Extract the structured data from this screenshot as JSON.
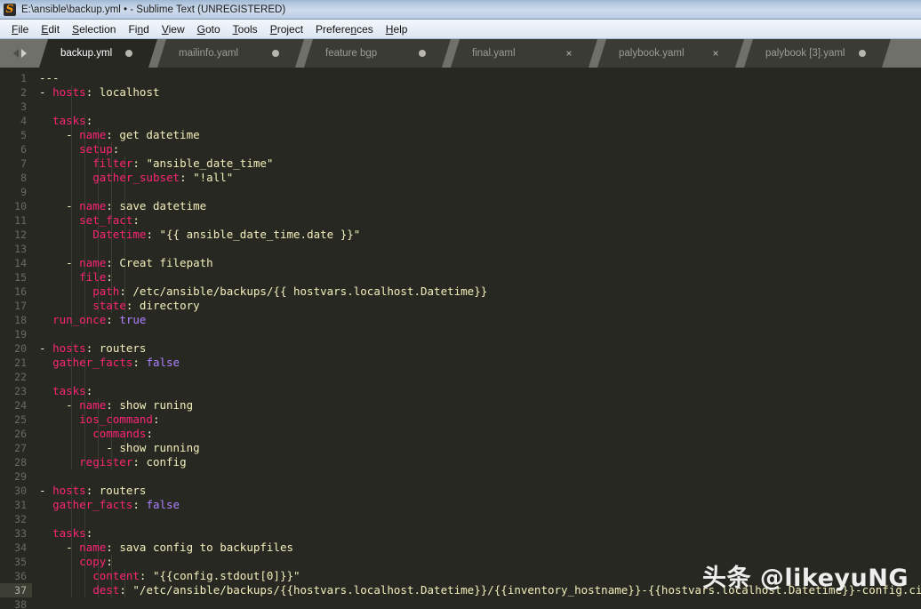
{
  "window": {
    "title": "E:\\ansible\\backup.yml • - Sublime Text (UNREGISTERED)",
    "logo_icon": "sublime-text-logo-icon"
  },
  "menu": {
    "items": [
      {
        "label": "File",
        "mnemonic": "F"
      },
      {
        "label": "Edit",
        "mnemonic": "E"
      },
      {
        "label": "Selection",
        "mnemonic": "S"
      },
      {
        "label": "Find",
        "mnemonic": "n"
      },
      {
        "label": "View",
        "mnemonic": "V"
      },
      {
        "label": "Goto",
        "mnemonic": "G"
      },
      {
        "label": "Tools",
        "mnemonic": "T"
      },
      {
        "label": "Project",
        "mnemonic": "P"
      },
      {
        "label": "Preferences",
        "mnemonic": "n"
      },
      {
        "label": "Help",
        "mnemonic": "H"
      }
    ]
  },
  "tabbar": {
    "prev_icon": "chevron-left-icon",
    "next_icon": "chevron-right-icon",
    "tabs": [
      {
        "label": "backup.yml",
        "active": true,
        "icon": "modified-dot-icon",
        "width": 133
      },
      {
        "label": "mailinfo.yaml",
        "active": false,
        "icon": "modified-dot-icon",
        "width": 165
      },
      {
        "label": "feature bgp",
        "active": false,
        "icon": "modified-dot-icon",
        "width": 165
      },
      {
        "label": "final.yaml",
        "active": false,
        "icon": "close-x-icon",
        "width": 165
      },
      {
        "label": "palybook.yaml",
        "active": false,
        "icon": "close-x-icon",
        "width": 165
      },
      {
        "label": "palybook [3].yaml",
        "active": false,
        "icon": "modified-dot-icon",
        "width": 165
      }
    ]
  },
  "editor": {
    "active_line": 37,
    "first_line": 1,
    "total_lines_shown": 38,
    "language": "YAML",
    "lines": [
      {
        "n": 1,
        "tokens": [
          {
            "t": "---",
            "c": "p"
          }
        ]
      },
      {
        "n": 2,
        "tokens": [
          {
            "t": "- ",
            "c": "d"
          },
          {
            "t": "hosts",
            "c": "k"
          },
          {
            "t": ": ",
            "c": "p"
          },
          {
            "t": "localhost",
            "c": "v"
          }
        ]
      },
      {
        "n": 3,
        "tokens": []
      },
      {
        "n": 4,
        "tokens": [
          {
            "t": "  ",
            "c": "p"
          },
          {
            "t": "tasks",
            "c": "k"
          },
          {
            "t": ":",
            "c": "p"
          }
        ]
      },
      {
        "n": 5,
        "tokens": [
          {
            "t": "    - ",
            "c": "d"
          },
          {
            "t": "name",
            "c": "k"
          },
          {
            "t": ": ",
            "c": "p"
          },
          {
            "t": "get datetime",
            "c": "v"
          }
        ]
      },
      {
        "n": 6,
        "tokens": [
          {
            "t": "      ",
            "c": "p"
          },
          {
            "t": "setup",
            "c": "k"
          },
          {
            "t": ":",
            "c": "p"
          }
        ]
      },
      {
        "n": 7,
        "tokens": [
          {
            "t": "        ",
            "c": "p"
          },
          {
            "t": "filter",
            "c": "k"
          },
          {
            "t": ": ",
            "c": "p"
          },
          {
            "t": "\"ansible_date_time\"",
            "c": "v"
          }
        ]
      },
      {
        "n": 8,
        "tokens": [
          {
            "t": "        ",
            "c": "p"
          },
          {
            "t": "gather_subset",
            "c": "k"
          },
          {
            "t": ": ",
            "c": "p"
          },
          {
            "t": "\"!all\"",
            "c": "v"
          }
        ]
      },
      {
        "n": 9,
        "tokens": []
      },
      {
        "n": 10,
        "tokens": [
          {
            "t": "    - ",
            "c": "d"
          },
          {
            "t": "name",
            "c": "k"
          },
          {
            "t": ": ",
            "c": "p"
          },
          {
            "t": "save datetime",
            "c": "v"
          }
        ]
      },
      {
        "n": 11,
        "tokens": [
          {
            "t": "      ",
            "c": "p"
          },
          {
            "t": "set_fact",
            "c": "k"
          },
          {
            "t": ":",
            "c": "p"
          }
        ]
      },
      {
        "n": 12,
        "tokens": [
          {
            "t": "        ",
            "c": "p"
          },
          {
            "t": "Datetime",
            "c": "k"
          },
          {
            "t": ": ",
            "c": "p"
          },
          {
            "t": "\"{{ ansible_date_time.date }}\"",
            "c": "v"
          }
        ]
      },
      {
        "n": 13,
        "tokens": []
      },
      {
        "n": 14,
        "tokens": [
          {
            "t": "    - ",
            "c": "d"
          },
          {
            "t": "name",
            "c": "k"
          },
          {
            "t": ": ",
            "c": "p"
          },
          {
            "t": "Creat filepath",
            "c": "v"
          }
        ]
      },
      {
        "n": 15,
        "tokens": [
          {
            "t": "      ",
            "c": "p"
          },
          {
            "t": "file",
            "c": "k"
          },
          {
            "t": ":",
            "c": "p"
          }
        ]
      },
      {
        "n": 16,
        "tokens": [
          {
            "t": "        ",
            "c": "p"
          },
          {
            "t": "path",
            "c": "k"
          },
          {
            "t": ": ",
            "c": "p"
          },
          {
            "t": "/etc/ansible/backups/{{ hostvars.localhost.Datetime}}",
            "c": "v"
          }
        ]
      },
      {
        "n": 17,
        "tokens": [
          {
            "t": "        ",
            "c": "p"
          },
          {
            "t": "state",
            "c": "k"
          },
          {
            "t": ": ",
            "c": "p"
          },
          {
            "t": "directory",
            "c": "v"
          }
        ]
      },
      {
        "n": 18,
        "tokens": [
          {
            "t": "  ",
            "c": "p"
          },
          {
            "t": "run_once",
            "c": "k"
          },
          {
            "t": ": ",
            "c": "p"
          },
          {
            "t": "true",
            "c": "b"
          }
        ]
      },
      {
        "n": 19,
        "tokens": []
      },
      {
        "n": 20,
        "tokens": [
          {
            "t": "- ",
            "c": "d"
          },
          {
            "t": "hosts",
            "c": "k"
          },
          {
            "t": ": ",
            "c": "p"
          },
          {
            "t": "routers",
            "c": "v"
          }
        ]
      },
      {
        "n": 21,
        "tokens": [
          {
            "t": "  ",
            "c": "p"
          },
          {
            "t": "gather_facts",
            "c": "k"
          },
          {
            "t": ": ",
            "c": "p"
          },
          {
            "t": "false",
            "c": "b"
          }
        ]
      },
      {
        "n": 22,
        "tokens": []
      },
      {
        "n": 23,
        "tokens": [
          {
            "t": "  ",
            "c": "p"
          },
          {
            "t": "tasks",
            "c": "k"
          },
          {
            "t": ":",
            "c": "p"
          }
        ]
      },
      {
        "n": 24,
        "tokens": [
          {
            "t": "    - ",
            "c": "d"
          },
          {
            "t": "name",
            "c": "k"
          },
          {
            "t": ": ",
            "c": "p"
          },
          {
            "t": "show runing",
            "c": "v"
          }
        ]
      },
      {
        "n": 25,
        "tokens": [
          {
            "t": "      ",
            "c": "p"
          },
          {
            "t": "ios_command",
            "c": "k"
          },
          {
            "t": ":",
            "c": "p"
          }
        ]
      },
      {
        "n": 26,
        "tokens": [
          {
            "t": "        ",
            "c": "p"
          },
          {
            "t": "commands",
            "c": "k"
          },
          {
            "t": ":",
            "c": "p"
          }
        ]
      },
      {
        "n": 27,
        "tokens": [
          {
            "t": "          - ",
            "c": "d"
          },
          {
            "t": "show running",
            "c": "v"
          }
        ]
      },
      {
        "n": 28,
        "tokens": [
          {
            "t": "      ",
            "c": "p"
          },
          {
            "t": "register",
            "c": "k"
          },
          {
            "t": ": ",
            "c": "p"
          },
          {
            "t": "config",
            "c": "v"
          }
        ]
      },
      {
        "n": 29,
        "tokens": []
      },
      {
        "n": 30,
        "tokens": [
          {
            "t": "- ",
            "c": "d"
          },
          {
            "t": "hosts",
            "c": "k"
          },
          {
            "t": ": ",
            "c": "p"
          },
          {
            "t": "routers",
            "c": "v"
          }
        ]
      },
      {
        "n": 31,
        "tokens": [
          {
            "t": "  ",
            "c": "p"
          },
          {
            "t": "gather_facts",
            "c": "k"
          },
          {
            "t": ": ",
            "c": "p"
          },
          {
            "t": "false",
            "c": "b"
          }
        ]
      },
      {
        "n": 32,
        "tokens": []
      },
      {
        "n": 33,
        "tokens": [
          {
            "t": "  ",
            "c": "p"
          },
          {
            "t": "tasks",
            "c": "k"
          },
          {
            "t": ":",
            "c": "p"
          }
        ]
      },
      {
        "n": 34,
        "tokens": [
          {
            "t": "    - ",
            "c": "d"
          },
          {
            "t": "name",
            "c": "k"
          },
          {
            "t": ": ",
            "c": "p"
          },
          {
            "t": "sava config to backupfiles",
            "c": "v"
          }
        ]
      },
      {
        "n": 35,
        "tokens": [
          {
            "t": "      ",
            "c": "p"
          },
          {
            "t": "copy",
            "c": "k"
          },
          {
            "t": ":",
            "c": "p"
          }
        ]
      },
      {
        "n": 36,
        "tokens": [
          {
            "t": "        ",
            "c": "p"
          },
          {
            "t": "content",
            "c": "k"
          },
          {
            "t": ": ",
            "c": "p"
          },
          {
            "t": "\"{{config.stdout[0]}}\"",
            "c": "v"
          }
        ]
      },
      {
        "n": 37,
        "tokens": [
          {
            "t": "        ",
            "c": "p"
          },
          {
            "t": "dest",
            "c": "k"
          },
          {
            "t": ": ",
            "c": "p"
          },
          {
            "t": "\"/etc/ansible/backups/{{hostvars.localhost.Datetime}}/{{inventory_hostname}}-{{hostvars.localhost.Datetime}}-config.cig",
            "c": "v"
          }
        ]
      },
      {
        "n": 38,
        "tokens": []
      }
    ]
  },
  "watermark": {
    "text": "头条 @likeyuNG"
  },
  "colors": {
    "editor_background": "#272822",
    "key": "#f92672",
    "value": "#f2efbb",
    "constant": "#ae81ff",
    "plain": "#f7f3cd",
    "gutter_text": "#6a6b60",
    "active_line_gutter": "#3e3f34",
    "tabbar_background": "#70706a",
    "tab_inactive": "#3b3b36",
    "titlebar_accent": "#b3c7de"
  }
}
